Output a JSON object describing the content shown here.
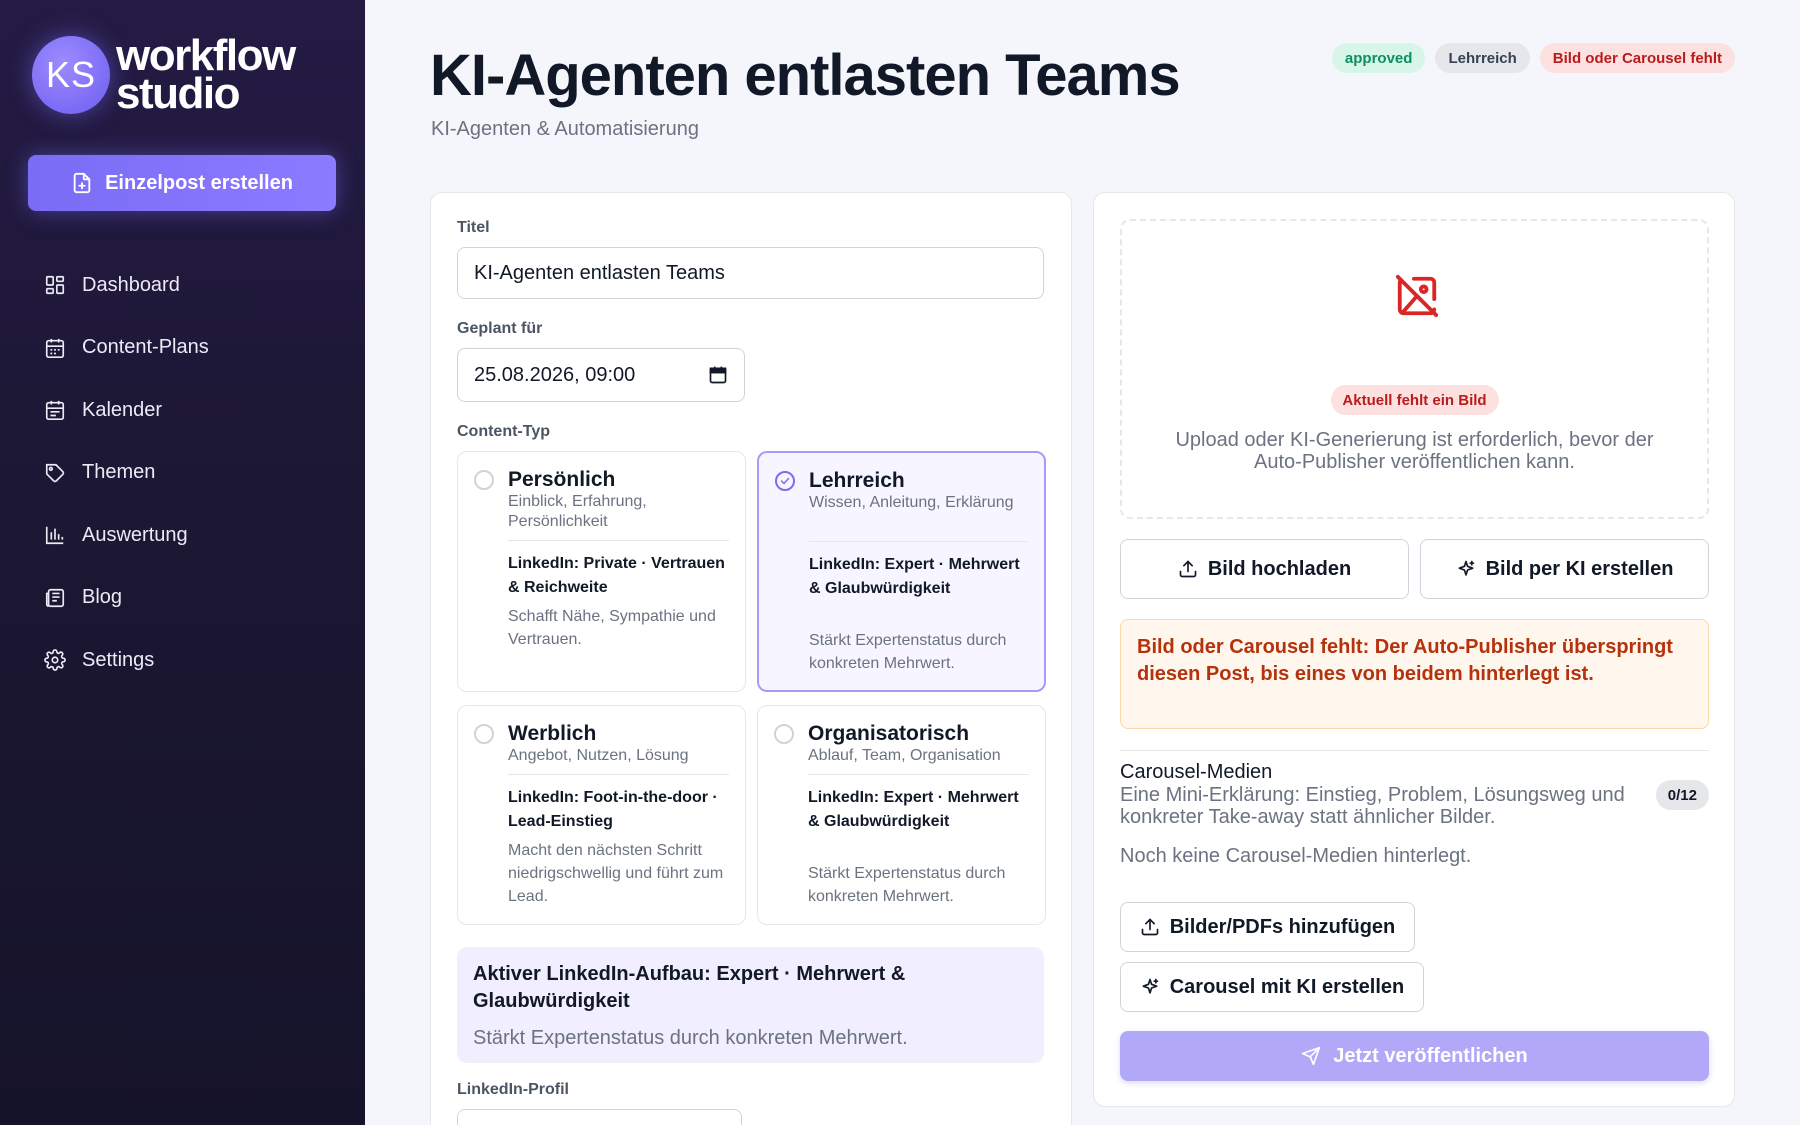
{
  "app": {
    "logo_initials": "KS",
    "logo_line1": "workflow",
    "logo_line2": "studio",
    "create_button": "Einzelpost erstellen"
  },
  "sidebar": {
    "items": [
      {
        "label": "Dashboard",
        "icon": "dashboard-icon"
      },
      {
        "label": "Content-Plans",
        "icon": "calendar-icon"
      },
      {
        "label": "Kalender",
        "icon": "calendar-icon"
      },
      {
        "label": "Themen",
        "icon": "tag-icon"
      },
      {
        "label": "Auswertung",
        "icon": "bar-chart-icon"
      },
      {
        "label": "Blog",
        "icon": "newspaper-icon"
      },
      {
        "label": "Settings",
        "icon": "gear-icon"
      }
    ]
  },
  "header": {
    "title": "KI-Agenten entlasten Teams",
    "subtitle": "KI-Agenten & Automatisierung",
    "badges": [
      "approved",
      "Lehrreich",
      "Bild oder Carousel fehlt"
    ]
  },
  "form": {
    "title_label": "Titel",
    "title_value": "KI-Agenten entlasten Teams",
    "scheduled_label": "Geplant für",
    "scheduled_value": "25.08.2026, 09:00",
    "content_type_label": "Content-Typ",
    "options": [
      {
        "title": "Persönlich",
        "desc": "Einblick, Erfahrung, Persönlichkeit",
        "linkedin": "LinkedIn: Private · Vertrauen & Reichweite",
        "note": "Schafft Nähe, Sympathie und Vertrauen.",
        "selected": false
      },
      {
        "title": "Lehrreich",
        "desc": "Wissen, Anleitung, Erklärung",
        "linkedin": "LinkedIn: Expert · Mehrwert & Glaubwürdigkeit",
        "note": "Stärkt Expertenstatus durch konkreten Mehrwert.",
        "selected": true
      },
      {
        "title": "Werblich",
        "desc": "Angebot, Nutzen, Lösung",
        "linkedin": "LinkedIn: Foot-in-the-door · Lead-Einstieg",
        "note": "Macht den nächsten Schritt niedrigschwellig und führt zum Lead.",
        "selected": false
      },
      {
        "title": "Organisatorisch",
        "desc": "Ablauf, Team, Organisation",
        "linkedin": "LinkedIn: Expert · Mehrwert & Glaubwürdigkeit",
        "note": "Stärkt Expertenstatus durch konkreten Mehrwert.",
        "selected": false
      }
    ],
    "active_title": "Aktiver LinkedIn-Aufbau: Expert · Mehrwert & Glaubwürdigkeit",
    "active_text": "Stärkt Expertenstatus durch konkreten Mehrwert.",
    "profile_label": "LinkedIn-Profil"
  },
  "media": {
    "missing_badge": "Aktuell fehlt ein Bild",
    "missing_text": "Upload oder KI-Generierung ist erforderlich, bevor der Auto-Publisher veröffentlichen kann.",
    "upload_button": "Bild hochladen",
    "ai_button": "Bild per KI erstellen",
    "warning": "Bild oder Carousel fehlt: Der Auto-Publisher überspringt diesen Post, bis eines von beidem hinterlegt ist.",
    "carousel_title": "Carousel-Medien",
    "carousel_desc": "Eine Mini-Erklärung: Einstieg, Problem, Lösungsweg und konkreter Take-away statt ähnlicher Bilder.",
    "carousel_count": "0/12",
    "carousel_empty": "Noch keine Carousel-Medien hinterlegt.",
    "add_files_button": "Bilder/PDFs hinzufügen",
    "carousel_ai_button": "Carousel mit KI erstellen",
    "publish_button": "Jetzt veröffentlichen"
  },
  "colors": {
    "accent": "#7a6cf5",
    "sidebar_bg": "#1c1733",
    "warning_text": "#b4320c",
    "approved_bg": "#d7f5e8",
    "missing_bg": "#fde0e0"
  }
}
